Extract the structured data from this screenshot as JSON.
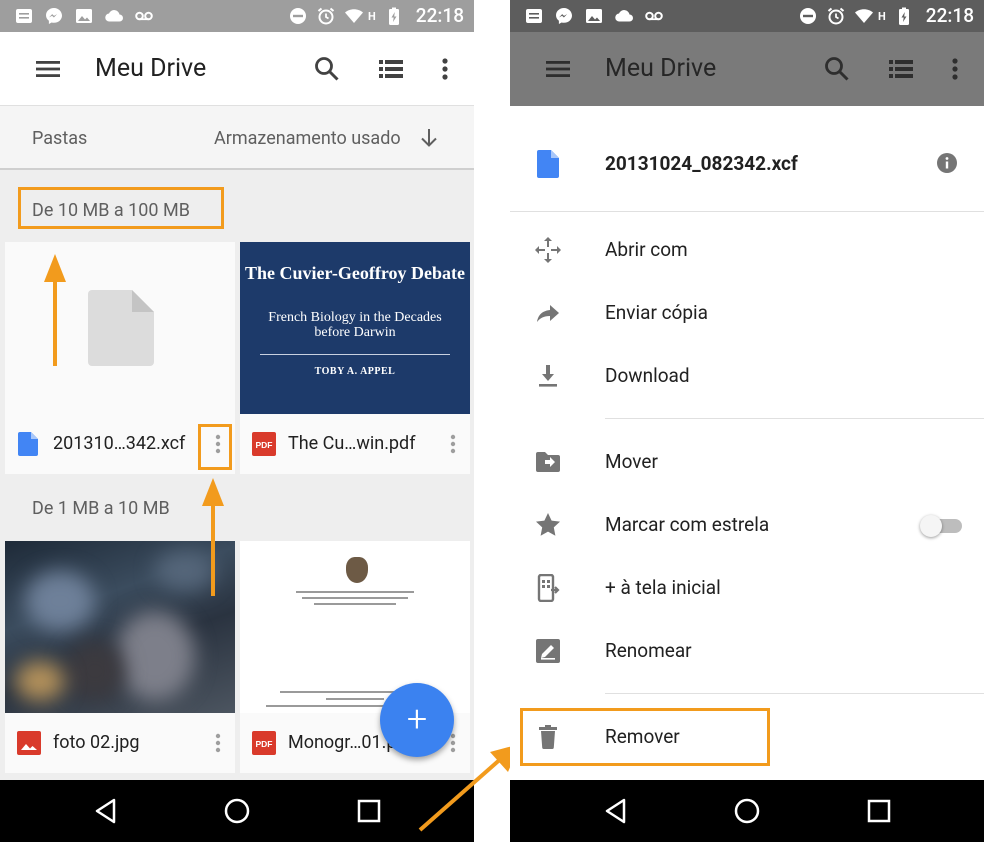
{
  "colors": {
    "highlight": "#f29b1d",
    "accent_blue": "#3b82f0",
    "pdf_red": "#d93a2b",
    "book_blue": "#1d3a6a"
  },
  "status_bar": {
    "time": "22:18",
    "network": "H",
    "icons": [
      "notes-icon",
      "messenger-icon",
      "image-icon",
      "cloud-icon",
      "voicemail-icon",
      "do-not-disturb-icon",
      "alarm-icon",
      "wifi-icon",
      "battery-charging-icon"
    ]
  },
  "left": {
    "toolbar": {
      "title": "Meu Drive",
      "icons": [
        "menu-icon",
        "search-icon",
        "list-view-icon",
        "more-vert-icon"
      ]
    },
    "sort": {
      "left_label": "Pastas",
      "right_label": "Armazenamento usado"
    },
    "sections": [
      {
        "label": "De 10 MB a 100 MB",
        "files": [
          {
            "name": "201310…342.xcf",
            "type": "file"
          },
          {
            "name": "The Cu…win.pdf",
            "type": "pdf"
          }
        ]
      },
      {
        "label": "De 1 MB a 10 MB",
        "files": [
          {
            "name": "foto 02.jpg",
            "type": "image"
          },
          {
            "name": "Monogr…01.pdf",
            "type": "pdf"
          }
        ]
      }
    ],
    "book_cover": {
      "title": "The Cuvier-Geoffroy Debate",
      "subtitle": "French Biology in the Decades before Darwin",
      "author": "TOBY A. APPEL"
    },
    "fab_label": "+"
  },
  "right": {
    "toolbar": {
      "title": "Meu Drive"
    },
    "sheet": {
      "file_name": "20131024_082342.xcf",
      "menu": [
        {
          "label": "Abrir com",
          "icon": "open-with-icon"
        },
        {
          "label": "Enviar cópia",
          "icon": "share-icon"
        },
        {
          "label": "Download",
          "icon": "download-icon"
        },
        {
          "label": "Mover",
          "icon": "move-to-folder-icon"
        },
        {
          "label": "Marcar com estrela",
          "icon": "star-icon",
          "toggle": false
        },
        {
          "label": "+ à tela inicial",
          "icon": "add-to-home-icon"
        },
        {
          "label": "Renomear",
          "icon": "rename-icon"
        },
        {
          "label": "Remover",
          "icon": "trash-icon"
        }
      ]
    }
  },
  "nav_bar": {
    "buttons": [
      "back-icon",
      "home-icon",
      "recents-icon"
    ]
  }
}
